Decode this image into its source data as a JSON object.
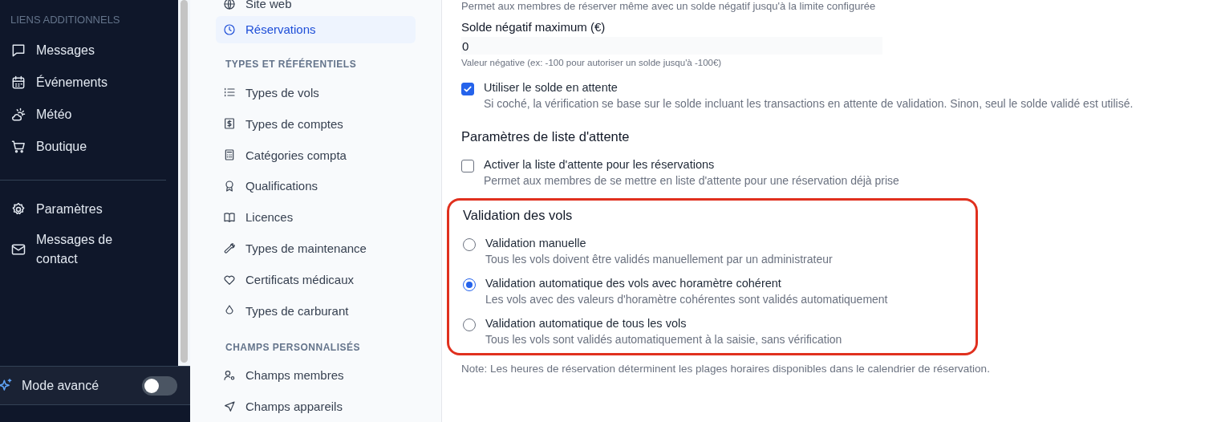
{
  "sidebar": {
    "section_title": "LIENS ADDITIONNELS",
    "items": [
      {
        "label": "Messages"
      },
      {
        "label": "Événements"
      },
      {
        "label": "Météo"
      },
      {
        "label": "Boutique"
      }
    ],
    "bottom_items": [
      {
        "label": "Paramètres"
      },
      {
        "label": "Messages de contact"
      }
    ],
    "advanced_mode": {
      "label": "Mode avancé",
      "on": false
    }
  },
  "settings_nav": {
    "groups": [
      {
        "items": [
          {
            "label": "Site web",
            "selected": false
          },
          {
            "label": "Réservations",
            "selected": true
          }
        ]
      },
      {
        "title": "TYPES ET RÉFÉRENTIELS",
        "items": [
          {
            "label": "Types de vols",
            "selected": false
          },
          {
            "label": "Types de comptes",
            "selected": false
          },
          {
            "label": "Catégories compta",
            "selected": false
          },
          {
            "label": "Qualifications",
            "selected": false
          },
          {
            "label": "Licences",
            "selected": false
          },
          {
            "label": "Types de maintenance",
            "selected": false
          },
          {
            "label": "Certificats médicaux",
            "selected": false
          },
          {
            "label": "Types de carburant",
            "selected": false
          }
        ]
      },
      {
        "title": "CHAMPS PERSONNALISÉS",
        "items": [
          {
            "label": "Champs membres",
            "selected": false
          },
          {
            "label": "Champs appareils",
            "selected": false
          }
        ]
      }
    ]
  },
  "main": {
    "top_description": "Permet aux membres de réserver même avec un solde négatif jusqu'à la limite configurée",
    "max_negative": {
      "label": "Solde négatif maximum (€)",
      "value": "0",
      "hint": "Valeur négative (ex: -100 pour autoriser un solde jusqu'à -100€)"
    },
    "pending_balance": {
      "label": "Utiliser le solde en attente",
      "description": "Si coché, la vérification se base sur le solde incluant les transactions en attente de validation. Sinon, seul le solde validé est utilisé.",
      "checked": true
    },
    "waitlist": {
      "title": "Paramètres de liste d'attente",
      "label": "Activer la liste d'attente pour les réservations",
      "description": "Permet aux membres de se mettre en liste d'attente pour une réservation déjà prise",
      "checked": false
    },
    "flight_validation": {
      "title": "Validation des vols",
      "highlighted": true,
      "options": [
        {
          "label": "Validation manuelle",
          "description": "Tous les vols doivent être validés manuellement par un administrateur",
          "selected": false
        },
        {
          "label": "Validation automatique des vols avec horamètre cohérent",
          "description": "Les vols avec des valeurs d'horamètre cohérentes sont validés automatiquement",
          "selected": true
        },
        {
          "label": "Validation automatique de tous les vols",
          "description": "Tous les vols sont validés automatiquement à la saisie, sans vérification",
          "selected": false
        }
      ]
    },
    "note": "Note: Les heures de réservation déterminent les plages horaires disponibles dans le calendrier de réservation."
  }
}
